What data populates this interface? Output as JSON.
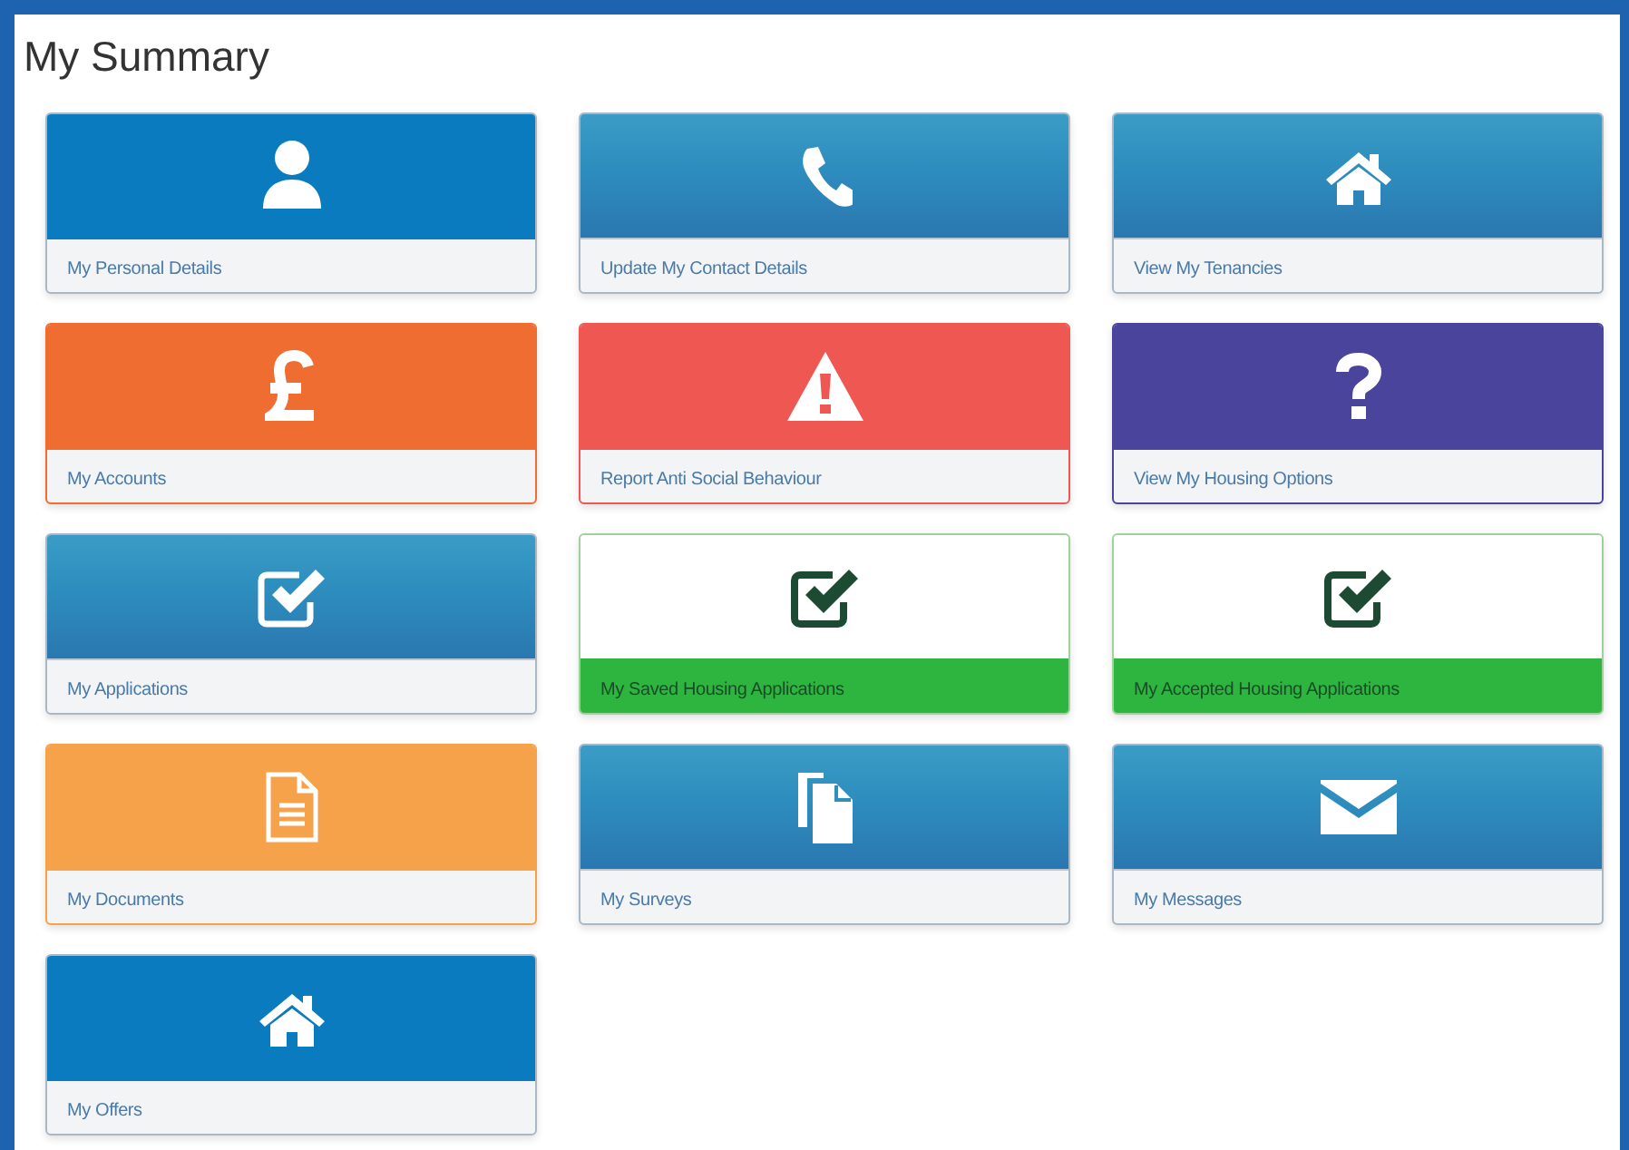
{
  "title": "My Summary",
  "tiles": [
    {
      "label": "My Personal Details",
      "kind": "user",
      "color": "#0a7bbf"
    },
    {
      "label": "Update My Contact Details",
      "kind": "phone",
      "color": "#2e8fbf"
    },
    {
      "label": "View My Tenancies",
      "kind": "home",
      "color": "#2e8fbf"
    },
    {
      "label": "My Accounts",
      "kind": "pound",
      "color": "#f06d32"
    },
    {
      "label": "Report Anti Social Behaviour",
      "kind": "warning",
      "color": "#ef5752"
    },
    {
      "label": "View My Housing Options",
      "kind": "question",
      "color": "#4b449c"
    },
    {
      "label": "My Applications",
      "kind": "checkbox",
      "color": "#2e8fbf"
    },
    {
      "label": "My Saved Housing Applications",
      "kind": "check",
      "color": "#2db540"
    },
    {
      "label": "My Accepted Housing Applications",
      "kind": "check",
      "color": "#2db540"
    },
    {
      "label": "My Documents",
      "kind": "file",
      "color": "#f6a24a"
    },
    {
      "label": "My Surveys",
      "kind": "copy",
      "color": "#2e8fbf"
    },
    {
      "label": "My Messages",
      "kind": "envelope",
      "color": "#2e8fbf"
    },
    {
      "label": "My Offers",
      "kind": "home",
      "color": "#0a7bbf"
    }
  ]
}
